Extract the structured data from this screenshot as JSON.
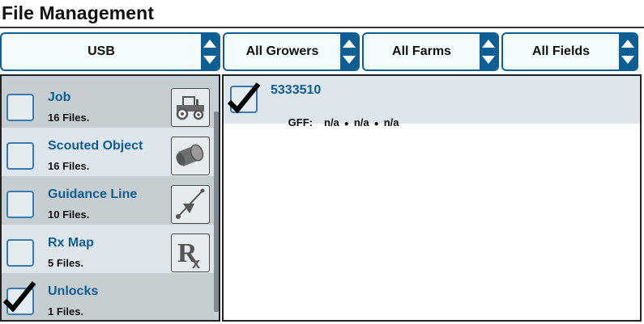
{
  "title": "File Management",
  "selectors": {
    "source": "USB",
    "grower": "All Growers",
    "farm": "All Farms",
    "field": "All Fields"
  },
  "categories": [
    {
      "name": "Job",
      "files": "16 Files.",
      "checked": false,
      "icon": "tractor-icon"
    },
    {
      "name": "Scouted Object",
      "files": "16 Files.",
      "checked": false,
      "icon": "scouted-object-icon"
    },
    {
      "name": "Guidance Line",
      "files": "10 Files.",
      "checked": false,
      "icon": "guidance-line-icon"
    },
    {
      "name": "Rx Map",
      "files": "5 Files.",
      "checked": false,
      "icon": "rx-icon"
    },
    {
      "name": "Unlocks",
      "files": "1 Files.",
      "checked": true,
      "icon": ""
    }
  ],
  "file_list": [
    {
      "name": "5333510",
      "gff_label": "GFF:",
      "grower": "n/a",
      "farm": "n/a",
      "field": "n/a",
      "separator": "●",
      "checked": true
    }
  ],
  "colors": {
    "accent": "#0d5f93",
    "link": "#0f5e93",
    "row_dark": "#c6ced2",
    "row_light": "#dfe6eb"
  }
}
